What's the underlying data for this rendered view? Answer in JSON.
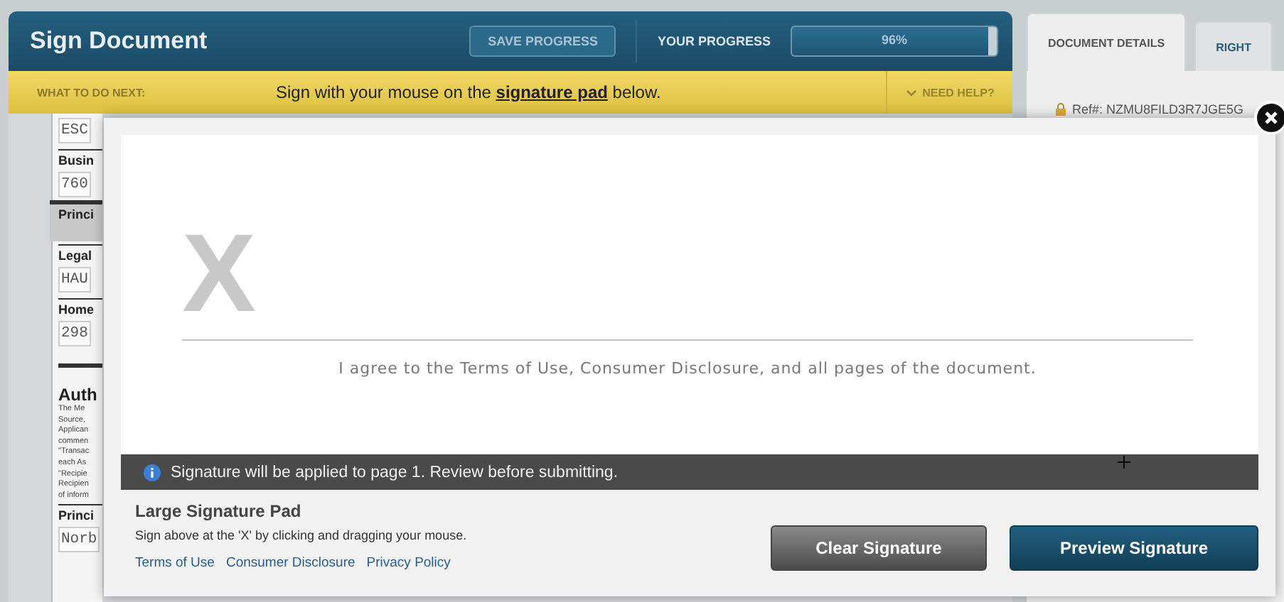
{
  "header": {
    "title": "Sign Document",
    "save_button": "SAVE PROGRESS",
    "progress_label": "YOUR PROGRESS",
    "progress": {
      "level": 0.96,
      "reading": "96%"
    }
  },
  "next_bar": {
    "label": "WHAT TO DO NEXT:",
    "instruction": {
      "before": "Sign with your mouse on the ",
      "link": "signature pad",
      "after": " below."
    },
    "help": "NEED HELP?"
  },
  "document": {
    "items": [
      {
        "kind": "value",
        "text": "ESC"
      },
      {
        "kind": "label",
        "text": "Busin"
      },
      {
        "kind": "value",
        "text": "760"
      },
      {
        "kind": "section",
        "text": "Princi"
      },
      {
        "kind": "label",
        "text": "Legal"
      },
      {
        "kind": "value",
        "text": "HAU"
      },
      {
        "kind": "label",
        "text": "Home"
      },
      {
        "kind": "value",
        "text": "298"
      },
      {
        "kind": "heading",
        "text": "Auth"
      },
      {
        "kind": "fine",
        "text": "The Me"
      },
      {
        "kind": "fine",
        "text": "Source,"
      },
      {
        "kind": "fine",
        "text": "Applican"
      },
      {
        "kind": "fine",
        "text": "commen"
      },
      {
        "kind": "fine",
        "text": "\"Transac"
      },
      {
        "kind": "fine",
        "text": "each As"
      },
      {
        "kind": "fine",
        "text": "\"Recipie"
      },
      {
        "kind": "fine",
        "text": "Recipien"
      },
      {
        "kind": "fine",
        "text": "of inform"
      },
      {
        "kind": "label",
        "text": "Princi"
      },
      {
        "kind": "value",
        "text": "Norb"
      }
    ]
  },
  "side_panel": {
    "tabs": [
      {
        "label": "DOCUMENT DETAILS",
        "selected": true
      },
      {
        "label": "RIGHT",
        "selected": false
      }
    ],
    "ref": "Ref#: NZMU8FILD3R7JGE5G"
  },
  "modal": {
    "mark": "X",
    "agreement": "I agree to the Terms of Use, Consumer Disclosure, and all pages of the document.",
    "notice": "Signature will be applied to page 1. Review before submitting.",
    "title": "Large Signature Pad",
    "hint": "Sign above at the 'X' by clicking and dragging your mouse.",
    "links": [
      "Terms of Use",
      "Consumer Disclosure",
      "Privacy Policy"
    ],
    "buttons": [
      {
        "label": "Clear Signature",
        "kind": "secondary"
      },
      {
        "label": "Preview Signature",
        "kind": "primary"
      }
    ]
  }
}
